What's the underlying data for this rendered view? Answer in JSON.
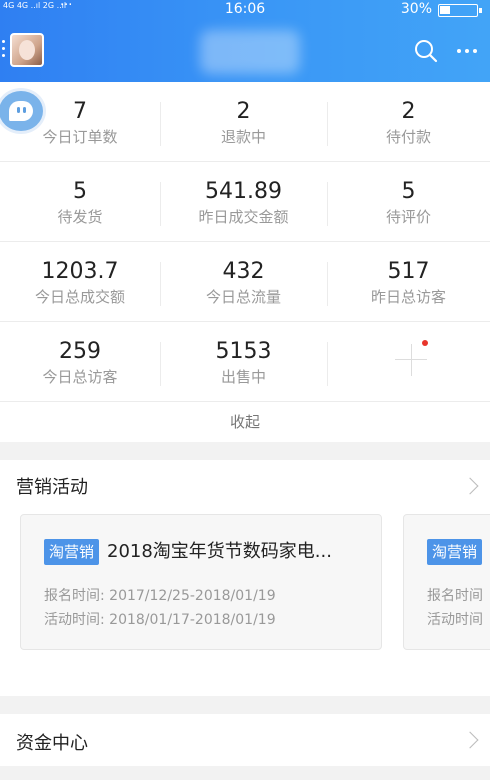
{
  "status_bar": {
    "signal": "4G 4G ..ıl 2G ..ıl",
    "dots": "···",
    "time": "16:06",
    "battery": "30%"
  },
  "stats": [
    [
      {
        "value": "7",
        "label": "今日订单数"
      },
      {
        "value": "2",
        "label": "退款中"
      },
      {
        "value": "2",
        "label": "待付款"
      }
    ],
    [
      {
        "value": "5",
        "label": "待发货"
      },
      {
        "value": "541.89",
        "label": "昨日成交金额"
      },
      {
        "value": "5",
        "label": "待评价"
      }
    ],
    [
      {
        "value": "1203.7",
        "label": "今日总成交额"
      },
      {
        "value": "432",
        "label": "今日总流量"
      },
      {
        "value": "517",
        "label": "昨日总访客"
      }
    ],
    [
      {
        "value": "259",
        "label": "今日总访客"
      },
      {
        "value": "5153",
        "label": "出售中"
      }
    ]
  ],
  "collapse_label": "收起",
  "marketing": {
    "title": "营销活动",
    "cards": [
      {
        "tag": "淘营销",
        "title": "2018淘宝年货节数码家电...",
        "signup": "报名时间: 2017/12/25-2018/01/19",
        "activity": "活动时间: 2018/01/17-2018/01/19"
      },
      {
        "tag": "淘营销",
        "title": "",
        "signup": "报名时间",
        "activity": "活动时间"
      }
    ]
  },
  "fund_center": {
    "title": "资金中心"
  },
  "colors": {
    "header_blue": "#3a8ff4",
    "tag_blue": "#4d94e8",
    "red_dot": "#e8352b"
  }
}
